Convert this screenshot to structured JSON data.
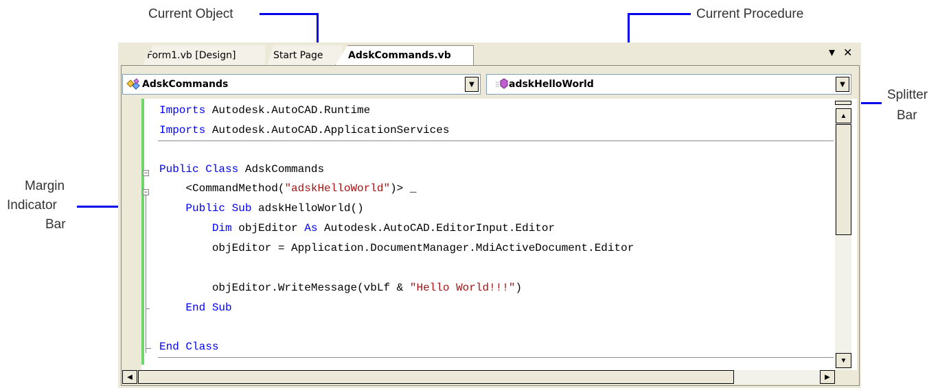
{
  "callouts": {
    "current_object": "Current Object",
    "current_procedure": "Current Procedure",
    "splitter_line1": "Splitter",
    "splitter_line2": "Bar",
    "margin_line1": "Margin",
    "margin_line2": "Indicator",
    "margin_line3": "Bar"
  },
  "tabs": [
    {
      "label": "Form1.vb [Design]"
    },
    {
      "label": "Start Page"
    },
    {
      "label": "AdskCommands.vb"
    }
  ],
  "tab_controls": {
    "dropdown_glyph": "▾",
    "close_glyph": "✕"
  },
  "object_dropdown": {
    "value": "AdskCommands",
    "icon": "class-icon"
  },
  "procedure_dropdown": {
    "value": "adskHelloWorld",
    "icon": "method-icon"
  },
  "code": {
    "l1_kw": "Imports",
    "l1_rest": " Autodesk.AutoCAD.Runtime",
    "l2_kw": "Imports",
    "l2_rest": " Autodesk.AutoCAD.ApplicationServices",
    "l3_kw1": "Public",
    "l3_kw2": "Class",
    "l3_rest": " AdskCommands",
    "l4_pre": "    <CommandMethod(",
    "l4_str": "\"adskHelloWorld\"",
    "l4_post": ")> _",
    "l5_kw1": "Public",
    "l5_kw2": "Sub",
    "l5_rest": " adskHelloWorld()",
    "l6_kw1": "Dim",
    "l6_mid": " objEditor ",
    "l6_kw2": "As",
    "l6_rest": " Autodesk.AutoCAD.EditorInput.Editor",
    "l7": "        objEditor = Application.DocumentManager.MdiActiveDocument.Editor",
    "l8_pre": "        objEditor.WriteMessage(vbLf & ",
    "l8_str": "\"Hello World!!!\"",
    "l8_post": ")",
    "l9_kw": "End Sub",
    "l10_kw": "End Class"
  },
  "colors": {
    "keyword": "#0000ff",
    "string": "#a31515",
    "margin_bar": "#6cd86c",
    "callout_line": "#0000ee"
  }
}
